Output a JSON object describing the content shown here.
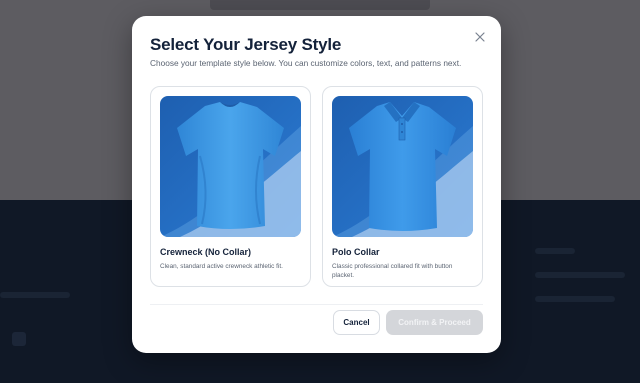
{
  "modal": {
    "title": "Select Your Jersey Style",
    "subtitle": "Choose your template style below. You can customize colors, text, and patterns next."
  },
  "options": [
    {
      "title": "Crewneck (No Collar)",
      "description": "Clean, standard active crewneck athletic fit.",
      "icon": "crewneck-jersey-image"
    },
    {
      "title": "Polo Collar",
      "description": "Classic professional collared fit with button placket.",
      "icon": "polo-jersey-image"
    }
  ],
  "actions": {
    "cancel_label": "Cancel",
    "confirm_label": "Confirm & Proceed"
  },
  "colors": {
    "accent": "#2f8ee0",
    "title": "#14223a",
    "confirm_disabled": "#d4d6da"
  }
}
